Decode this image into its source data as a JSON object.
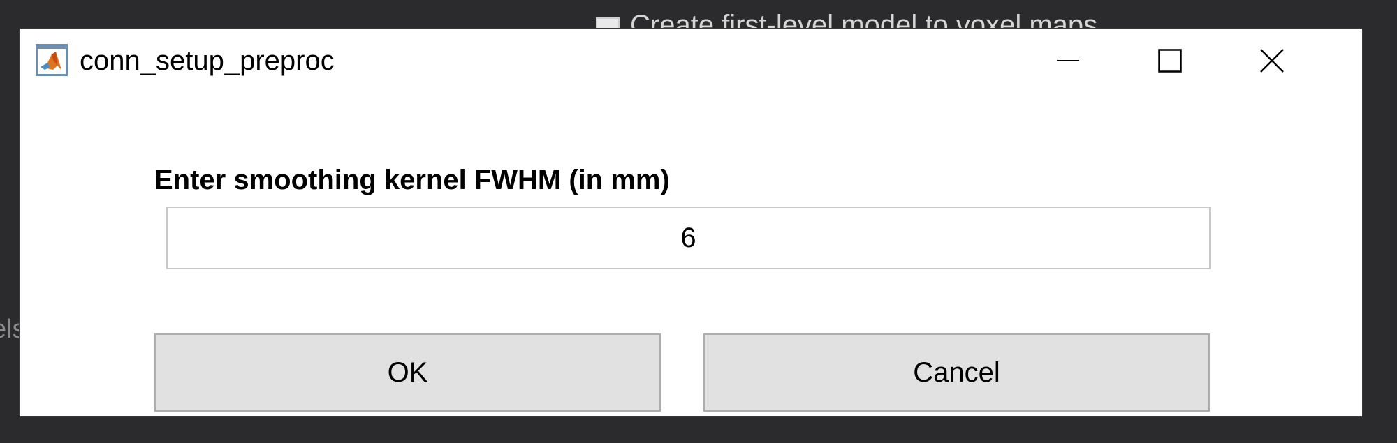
{
  "background": {
    "top_text": "Create first-level model to voxel maps",
    "left_text": "els"
  },
  "window": {
    "title": "conn_setup_preproc",
    "icon": "matlab-logo-icon",
    "controls": {
      "minimize": "minimize-icon",
      "maximize": "maximize-icon",
      "close": "close-icon"
    }
  },
  "dialog": {
    "prompt": "Enter smoothing kernel FWHM (in mm)",
    "input_value": "6",
    "ok_label": "OK",
    "cancel_label": "Cancel"
  },
  "colors": {
    "background": "#2b2b2d",
    "dialog_bg": "#ffffff",
    "button_bg": "#e1e1e1",
    "button_border": "#adadad",
    "input_border": "#c8c8c8"
  }
}
